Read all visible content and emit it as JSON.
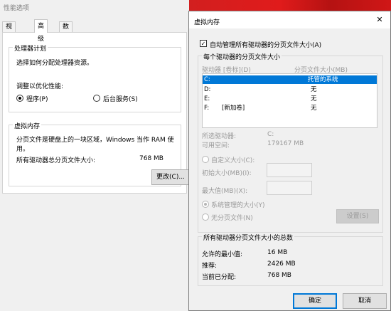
{
  "perf_window": {
    "title": "性能选项",
    "tabs": [
      "视觉效果",
      "高级",
      "数据执行保护"
    ],
    "active_tab_index": 1,
    "processor": {
      "group_title": "处理器计划",
      "description": "选择如何分配处理器资源。",
      "optimize_label": "调整以优化性能:",
      "options": [
        {
          "label": "程序(P)",
          "selected": true
        },
        {
          "label": "后台服务(S)",
          "selected": false
        }
      ]
    },
    "virtual_memory": {
      "group_title": "虚拟内存",
      "description": "分页文件是硬盘上的一块区域，Windows 当作 RAM 使用。",
      "total_label": "所有驱动器总分页文件大小:",
      "total_value": "768 MB",
      "change_button": "更改(C)..."
    }
  },
  "vm_dialog": {
    "title": "虚拟内存",
    "close_glyph": "✕",
    "auto_manage": {
      "label": "自动管理所有驱动器的分页文件大小(A)",
      "checked": true,
      "check_glyph": "✓"
    },
    "per_drive": {
      "group_title": "每个驱动器的分页文件大小",
      "col_drive": "驱动器 [卷标](D)",
      "col_size": "分页文件大小(MB)",
      "drives": [
        {
          "drive": "C:",
          "label": "",
          "size": "托管的系统",
          "selected": true
        },
        {
          "drive": "D:",
          "label": "",
          "size": "无",
          "selected": false
        },
        {
          "drive": "E:",
          "label": "",
          "size": "无",
          "selected": false
        },
        {
          "drive": "F:",
          "label": "[新加卷]",
          "size": "无",
          "selected": false
        }
      ],
      "selected_drive_label": "所选驱动器:",
      "selected_drive_value": "C:",
      "free_space_label": "可用空间:",
      "free_space_value": "179167 MB",
      "custom_size_label": "自定义大小(C):",
      "initial_size_label": "初始大小(MB)(I):",
      "max_size_label": "最大值(MB)(X):",
      "system_managed_label": "系统管理的大小(Y)",
      "no_paging_label": "无分页文件(N)",
      "set_button": "设置(S)"
    },
    "totals": {
      "group_title": "所有驱动器分页文件大小的总数",
      "min_label": "允许的最小值:",
      "min_value": "16 MB",
      "recommended_label": "推荐:",
      "recommended_value": "2426 MB",
      "allocated_label": "当前已分配:",
      "allocated_value": "768 MB"
    },
    "ok_button": "确定",
    "cancel_button": "取消"
  },
  "colors": {
    "accent": "#0078d7",
    "desktop_red": "#d21f1f"
  }
}
